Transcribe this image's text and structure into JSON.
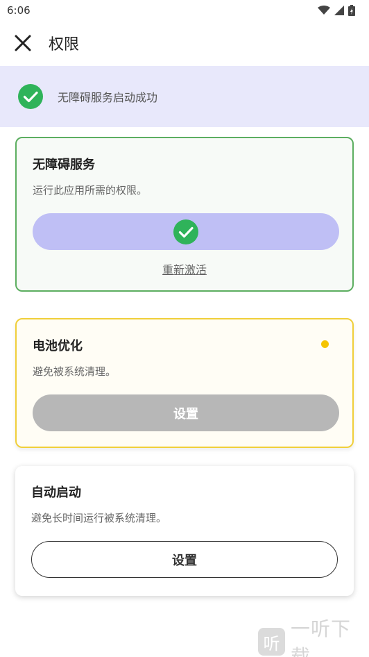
{
  "status_bar": {
    "time": "6:06",
    "icons": [
      "wifi-icon",
      "signal-icon",
      "battery-icon"
    ]
  },
  "app_bar": {
    "close_icon": "close-icon",
    "title": "权限"
  },
  "banner": {
    "icon": "check-circle-icon",
    "text": "无障碍服务启动成功",
    "accent_color": "#2fb35a"
  },
  "cards": {
    "accessibility": {
      "title": "无障碍服务",
      "description": "运行此应用所需的权限。",
      "button_icon": "check-circle-icon",
      "link_label": "重新激活",
      "status": "enabled",
      "border_color": "#5cae60"
    },
    "battery": {
      "title": "电池优化",
      "description": "避免被系统清理。",
      "button_label": "设置",
      "status": "pending",
      "status_color": "#f5c400"
    },
    "autostart": {
      "title": "自动启动",
      "description": "避免长时间运行被系统清理。",
      "button_label": "设置"
    }
  },
  "watermark": {
    "logo_char": "听",
    "text": "一听下载"
  }
}
